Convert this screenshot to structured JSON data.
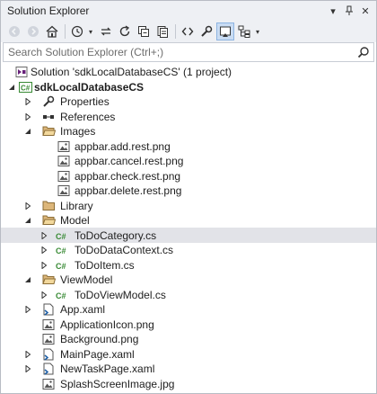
{
  "window": {
    "title": "Solution Explorer",
    "buttons": [
      "pin-icon",
      "close-icon"
    ]
  },
  "toolbar": {
    "icons": [
      "back-icon",
      "forward-icon",
      "home-icon",
      "history-icon",
      "sync-icon",
      "refresh-icon",
      "collapse-all-icon",
      "show-all-files-icon",
      "view-code-icon",
      "properties-icon",
      "preview-icon",
      "class-diagram-icon"
    ]
  },
  "search": {
    "placeholder": "Search Solution Explorer (Ctrl+;)"
  },
  "tree": {
    "solution": "Solution 'sdkLocalDatabaseCS' (1 project)",
    "project": "sdkLocalDatabaseCS",
    "properties": "Properties",
    "references": "References",
    "images": "Images",
    "img1": "appbar.add.rest.png",
    "img2": "appbar.cancel.rest.png",
    "img3": "appbar.check.rest.png",
    "img4": "appbar.delete.rest.png",
    "library": "Library",
    "model": "Model",
    "m1": "ToDoCategory.cs",
    "m2": "ToDoDataContext.cs",
    "m3": "ToDoItem.cs",
    "viewmodel": "ViewModel",
    "vm1": "ToDoViewModel.cs",
    "app": "App.xaml",
    "appicon": "ApplicationIcon.png",
    "background": "Background.png",
    "mainpage": "MainPage.xaml",
    "newtask": "NewTaskPage.xaml",
    "splash": "SplashScreenImage.jpg"
  },
  "colors": {
    "chrome": "#eef0f4",
    "selection": "#e2e3e8",
    "folder": "#dcb67a",
    "csharp": "#388a34"
  }
}
